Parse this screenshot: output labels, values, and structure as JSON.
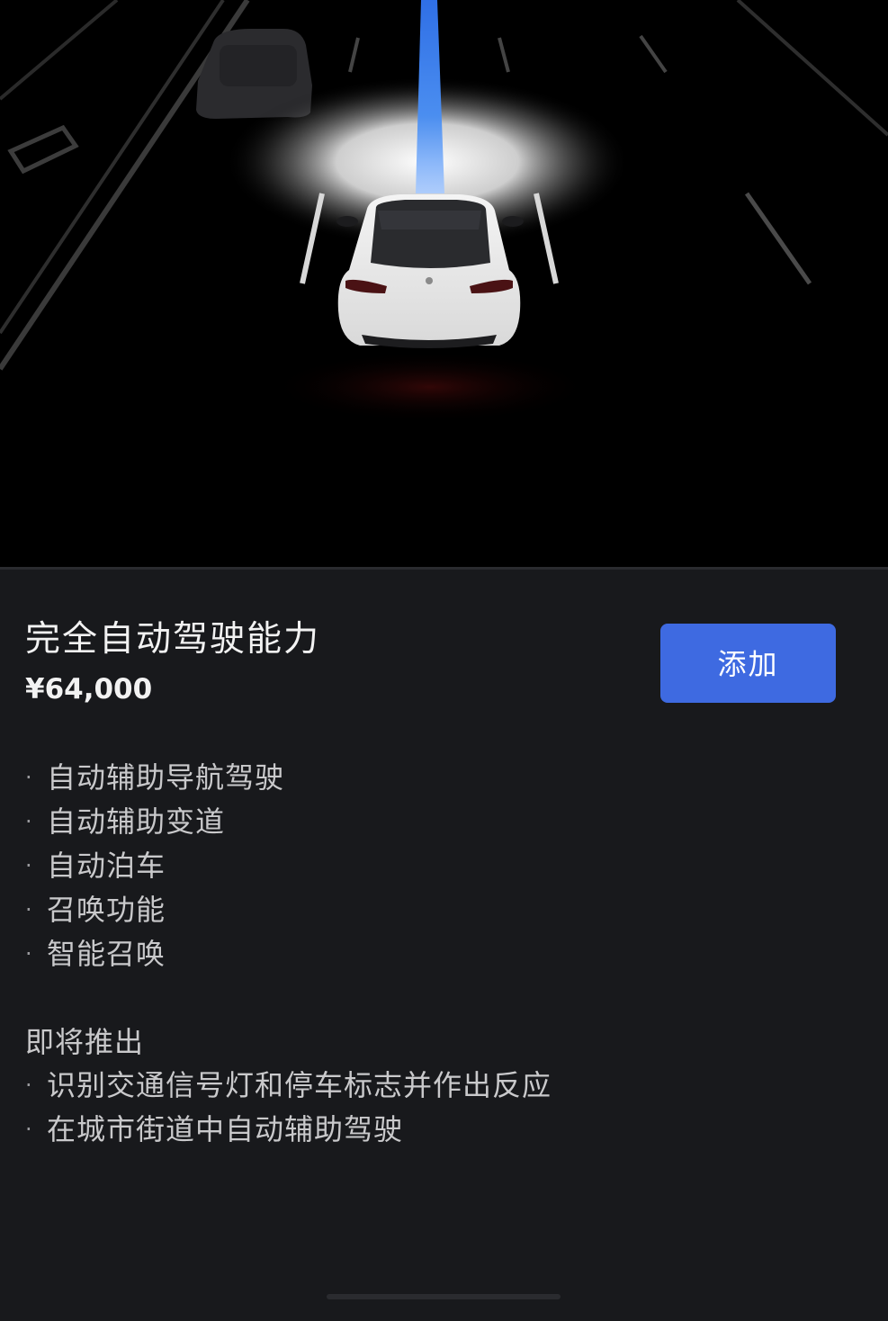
{
  "product": {
    "title": "完全自动驾驶能力",
    "price": "¥64,000",
    "add_label": "添加"
  },
  "features": [
    "自动辅助导航驾驶",
    "自动辅助变道",
    "自动泊车",
    "召唤功能",
    "智能召唤"
  ],
  "upcoming": {
    "heading": "即将推出",
    "items": [
      "识别交通信号灯和停车标志并作出反应",
      "在城市街道中自动辅助驾驶"
    ]
  },
  "bullet": "·",
  "colors": {
    "hero_background": "#000000",
    "panel_background": "#18191c",
    "accent_button": "#3e6ae1",
    "path_blue": "#3d7be8",
    "text_primary": "#f2f2f2",
    "text_secondary": "#c9c9cb"
  }
}
